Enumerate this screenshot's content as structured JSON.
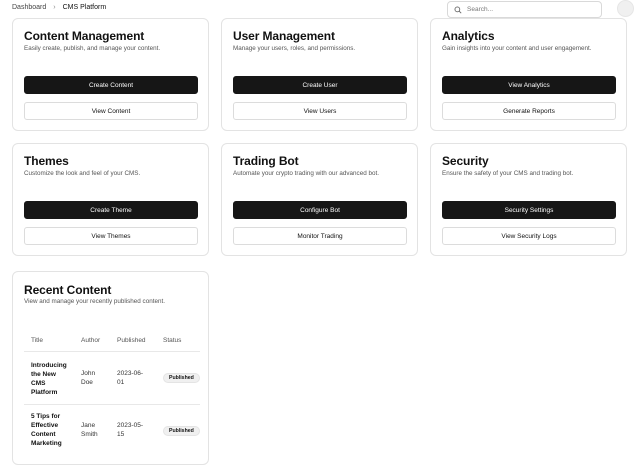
{
  "breadcrumb": {
    "items": [
      "Dashboard",
      "CMS Platform"
    ],
    "separator": "›"
  },
  "search": {
    "placeholder": "Search..."
  },
  "cards": [
    {
      "title": "Content Management",
      "description": "Easily create, publish, and manage your content.",
      "primary": "Create Content",
      "secondary": "View Content"
    },
    {
      "title": "User Management",
      "description": "Manage your users, roles, and permissions.",
      "primary": "Create User",
      "secondary": "View Users"
    },
    {
      "title": "Analytics",
      "description": "Gain insights into your content and user engagement.",
      "primary": "View Analytics",
      "secondary": "Generate Reports"
    },
    {
      "title": "Themes",
      "description": "Customize the look and feel of your CMS.",
      "primary": "Create Theme",
      "secondary": "View Themes"
    },
    {
      "title": "Trading Bot",
      "description": "Automate your crypto trading with our advanced bot.",
      "primary": "Configure Bot",
      "secondary": "Monitor Trading"
    },
    {
      "title": "Security",
      "description": "Ensure the safety of your CMS and trading bot.",
      "primary": "Security Settings",
      "secondary": "View Security Logs"
    }
  ],
  "recent": {
    "title": "Recent Content",
    "description": "View and manage your recently published content.",
    "columns": [
      "Title",
      "Author",
      "Published",
      "Status"
    ],
    "rows": [
      {
        "title_lines": [
          "Introducing",
          "the New",
          "CMS",
          "Platform"
        ],
        "author_lines": [
          "John",
          "Doe"
        ],
        "published_lines": [
          "2023-06-",
          "01"
        ],
        "status": "Published"
      },
      {
        "title_lines": [
          "5 Tips for",
          "Effective",
          "Content",
          "Marketing"
        ],
        "author_lines": [
          "Jane",
          "Smith"
        ],
        "published_lines": [
          "2023-05-",
          "15"
        ],
        "status": "Published"
      }
    ]
  },
  "colors": {
    "primary_button": "#161616",
    "card_border": "#e3e3e3",
    "badge_bg": "#f0f0f0"
  }
}
